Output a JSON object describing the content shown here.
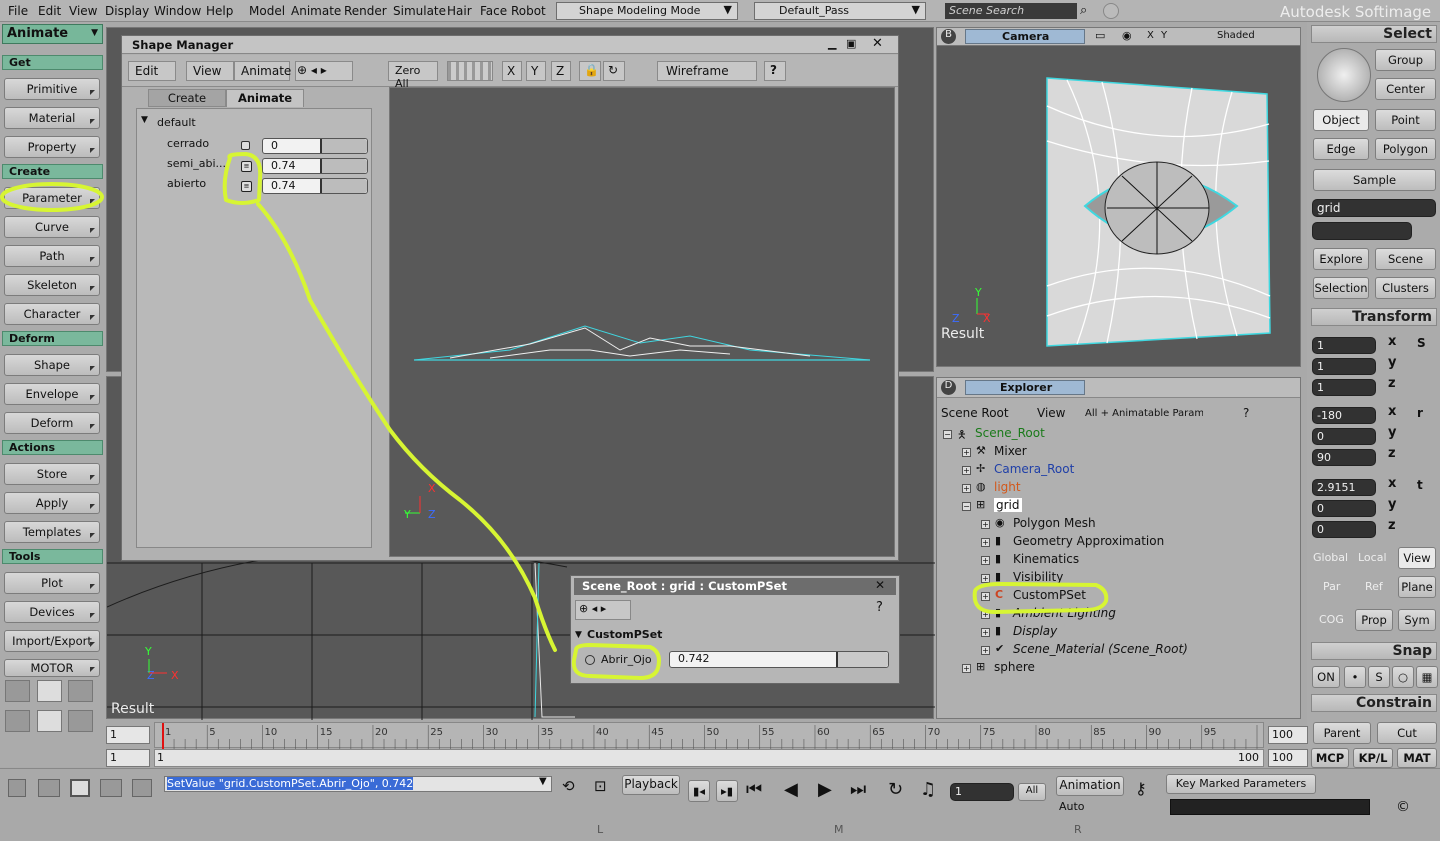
{
  "menubar": {
    "items": [
      "File",
      "Edit",
      "View",
      "Display",
      "Window",
      "Help",
      "Model",
      "Animate",
      "Render",
      "Simulate",
      "Hair",
      "Face Robot"
    ],
    "mode": "Shape Modeling Mode",
    "pass": "Default_Pass",
    "search_placeholder": "Scene Search",
    "brand": "Autodesk Softimage"
  },
  "left_palette": {
    "module": "Animate",
    "sections": [
      {
        "title": "Get",
        "buttons": [
          "Primitive",
          "Material",
          "Property"
        ]
      },
      {
        "title": "Create",
        "buttons": [
          "Parameter",
          "Curve",
          "Path",
          "Skeleton",
          "Character"
        ]
      },
      {
        "title": "Deform",
        "buttons": [
          "Shape",
          "Envelope",
          "Deform"
        ]
      },
      {
        "title": "Actions",
        "buttons": [
          "Store",
          "Apply",
          "Templates"
        ]
      },
      {
        "title": "Tools",
        "buttons": [
          "Plot",
          "Devices",
          "Import/Export"
        ]
      }
    ],
    "motor": "MOTOR"
  },
  "shape_manager": {
    "title": "Shape Manager",
    "toolbar": {
      "edit": "Edit",
      "view": "View",
      "animate": "Animate",
      "zero_all": "Zero All",
      "x": "X",
      "y": "Y",
      "z": "Z",
      "display": "Wireframe",
      "help": "?"
    },
    "tabs": [
      "Create",
      "Animate"
    ],
    "group": "default",
    "shapes": [
      {
        "name": "cerrado",
        "value": "0"
      },
      {
        "name": "semi_abi...",
        "value": "0.74"
      },
      {
        "name": "abierto",
        "value": "0.74"
      }
    ]
  },
  "camera": {
    "label": "Camera",
    "shading": "Shaded",
    "x": "X",
    "y": "Y",
    "result": "Result"
  },
  "viewport_bottom": {
    "result": "Result"
  },
  "custom_pset": {
    "title": "Scene_Root : grid : CustomPSet",
    "section": "CustomPSet",
    "param_name": "Abrir_Ojo",
    "param_value": "0.742"
  },
  "explorer": {
    "title": "Explorer",
    "scope": "Scene Root",
    "view": "View",
    "filter": "All + Animatable Params",
    "tree": [
      {
        "label": "Scene_Root",
        "color": "#1a7a1a",
        "depth": 0
      },
      {
        "label": "Mixer",
        "color": "#111111",
        "depth": 1
      },
      {
        "label": "Camera_Root",
        "color": "#1f3fa8",
        "depth": 1
      },
      {
        "label": "light",
        "color": "#d2581b",
        "depth": 1
      },
      {
        "label": "grid",
        "color": "#111111",
        "depth": 1
      },
      {
        "label": "Polygon Mesh",
        "color": "#111111",
        "depth": 2
      },
      {
        "label": "Geometry Approximation",
        "color": "#111111",
        "depth": 2
      },
      {
        "label": "Kinematics",
        "color": "#111111",
        "depth": 2
      },
      {
        "label": "Visibility",
        "color": "#111111",
        "depth": 2
      },
      {
        "label": "CustomPSet",
        "color": "#111111",
        "depth": 2
      },
      {
        "label": "Ambient Lighting",
        "color": "#111111",
        "depth": 2
      },
      {
        "label": "Display",
        "color": "#111111",
        "depth": 2
      },
      {
        "label": "Scene_Material (Scene_Root)",
        "color": "#111111",
        "depth": 2
      },
      {
        "label": "sphere",
        "color": "#111111",
        "depth": 1
      }
    ]
  },
  "right_palette": {
    "select": "Select",
    "group": "Group",
    "center": "Center",
    "object": "Object",
    "point": "Point",
    "edge": "Edge",
    "polygon": "Polygon",
    "sample": "Sample",
    "selection_name": "grid",
    "explore": "Explore",
    "scene": "Scene",
    "selection": "Selection",
    "clusters": "Clusters",
    "transform": "Transform",
    "scale": [
      "1",
      "1",
      "1"
    ],
    "rotate": [
      "-180",
      "0",
      "90"
    ],
    "translate": [
      "2.9151",
      "0",
      "0"
    ],
    "axes": [
      "x",
      "y",
      "z"
    ],
    "global": "Global",
    "local": "Local",
    "view": "View",
    "par": "Par",
    "ref": "Ref",
    "plane": "Plane",
    "cog": "COG",
    "prop": "Prop",
    "sym": "Sym",
    "snap": "Snap",
    "on": "ON",
    "constrain": "Constrain",
    "parent": "Parent",
    "cut": "Cut",
    "mcp": "MCP",
    "kpl": "KP/L",
    "mat": "MAT"
  },
  "timeline": {
    "start": "1",
    "end": "100",
    "current": "1",
    "end2": "100",
    "ticks": [
      "1",
      "5",
      "10",
      "15",
      "20",
      "25",
      "30",
      "35",
      "40",
      "45",
      "50",
      "55",
      "60",
      "65",
      "70",
      "75",
      "80",
      "85",
      "90",
      "95"
    ],
    "start_field": "1",
    "range_start": "1",
    "range_end": "100"
  },
  "bottom": {
    "command": "SetValue \"grid.CustomPSet.Abrir_Ojo\", 0.742",
    "playback": "Playback",
    "frame": "1",
    "all": "All",
    "animation": "Animation",
    "auto": "Auto",
    "key_marked": "Key Marked Parameters",
    "mouse": [
      "L",
      "M",
      "R"
    ]
  }
}
